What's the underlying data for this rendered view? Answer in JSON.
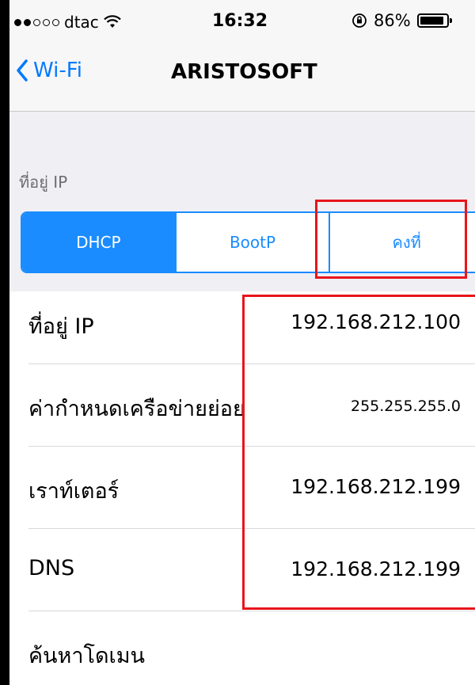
{
  "status_bar": {
    "carrier": "dtac",
    "signal_bars_filled": 2,
    "signal_bars_total": 5,
    "time": "16:32",
    "battery_percent": "86%",
    "battery_level": 0.86
  },
  "nav": {
    "back_label": "Wi-Fi",
    "title": "ARISTOSOFT"
  },
  "section": {
    "header": "ที่อยู่ IP"
  },
  "segments": [
    {
      "label": "DHCP",
      "selected": true
    },
    {
      "label": "BootP",
      "selected": false
    },
    {
      "label": "คงที่",
      "selected": false
    }
  ],
  "rows": [
    {
      "label": "ที่อยู่ IP",
      "value": "192.168.212.100"
    },
    {
      "label": "ค่ากำหนดเครือข่ายย่อย",
      "value": "255.255.255.0"
    },
    {
      "label": "เราท์เตอร์",
      "value": "192.168.212.199"
    },
    {
      "label": "DNS",
      "value": "192.168.212.199"
    },
    {
      "label": "ค้นหาโดเมน",
      "value": ""
    }
  ],
  "colors": {
    "accent": "#1a8cff",
    "annotation": "#e8151b",
    "grouped_background": "#efeff4"
  }
}
